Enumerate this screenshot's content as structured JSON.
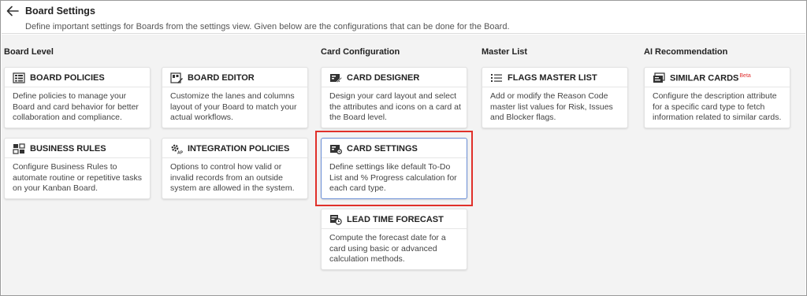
{
  "header": {
    "title": "Board Settings",
    "subtitle": "Define important settings for Boards from the settings view. Given below are the configurations that can be done for the Board."
  },
  "sections": {
    "board_level": "Board Level",
    "card_configuration": "Card Configuration",
    "master_list": "Master List",
    "ai_recommendation": "AI Recommendation"
  },
  "cards": {
    "board_policies": {
      "title": "BOARD POLICIES",
      "description": "Define policies to manage your Board and card behavior for better collaboration and compliance.",
      "icon": "policy-list-icon"
    },
    "board_editor": {
      "title": "BOARD EDITOR",
      "description": "Customize the lanes and columns layout of your Board to match your actual workflows.",
      "icon": "board-edit-icon"
    },
    "card_designer": {
      "title": "CARD DESIGNER",
      "description": "Design your card layout and select the attributes and icons on a card at the Board level.",
      "icon": "card-edit-icon"
    },
    "flags_master_list": {
      "title": "FLAGS MASTER LIST",
      "description": "Add or modify the Reason Code master list values for Risk, Issues and Blocker flags.",
      "icon": "list-icon"
    },
    "similar_cards": {
      "title": "SIMILAR CARDS",
      "badge": "Beta",
      "description": "Configure the description attribute for a specific card type to fetch information related to similar cards.",
      "icon": "similar-cards-icon"
    },
    "business_rules": {
      "title": "BUSINESS RULES",
      "description": "Configure Business Rules to automate routine or repetitive tasks on your Kanban Board.",
      "icon": "rules-icon"
    },
    "integration_policies": {
      "title": "INTEGRATION POLICIES",
      "description": "Options to control how valid or invalid records from an outside system are allowed in the system.",
      "icon": "api-gear-icon"
    },
    "card_settings": {
      "title": "CARD SETTINGS",
      "description": "Define settings like default To-Do List and % Progress calculation for each card type.",
      "icon": "card-settings-icon"
    },
    "lead_time_forecast": {
      "title": "LEAD TIME FORECAST",
      "description": "Compute the forecast date for a card using basic or advanced calculation methods.",
      "icon": "forecast-icon"
    }
  },
  "colors": {
    "highlight": "#e0302a",
    "selected_border": "#6b8ed6",
    "background": "#f3f3f3",
    "beta": "#e03030"
  }
}
